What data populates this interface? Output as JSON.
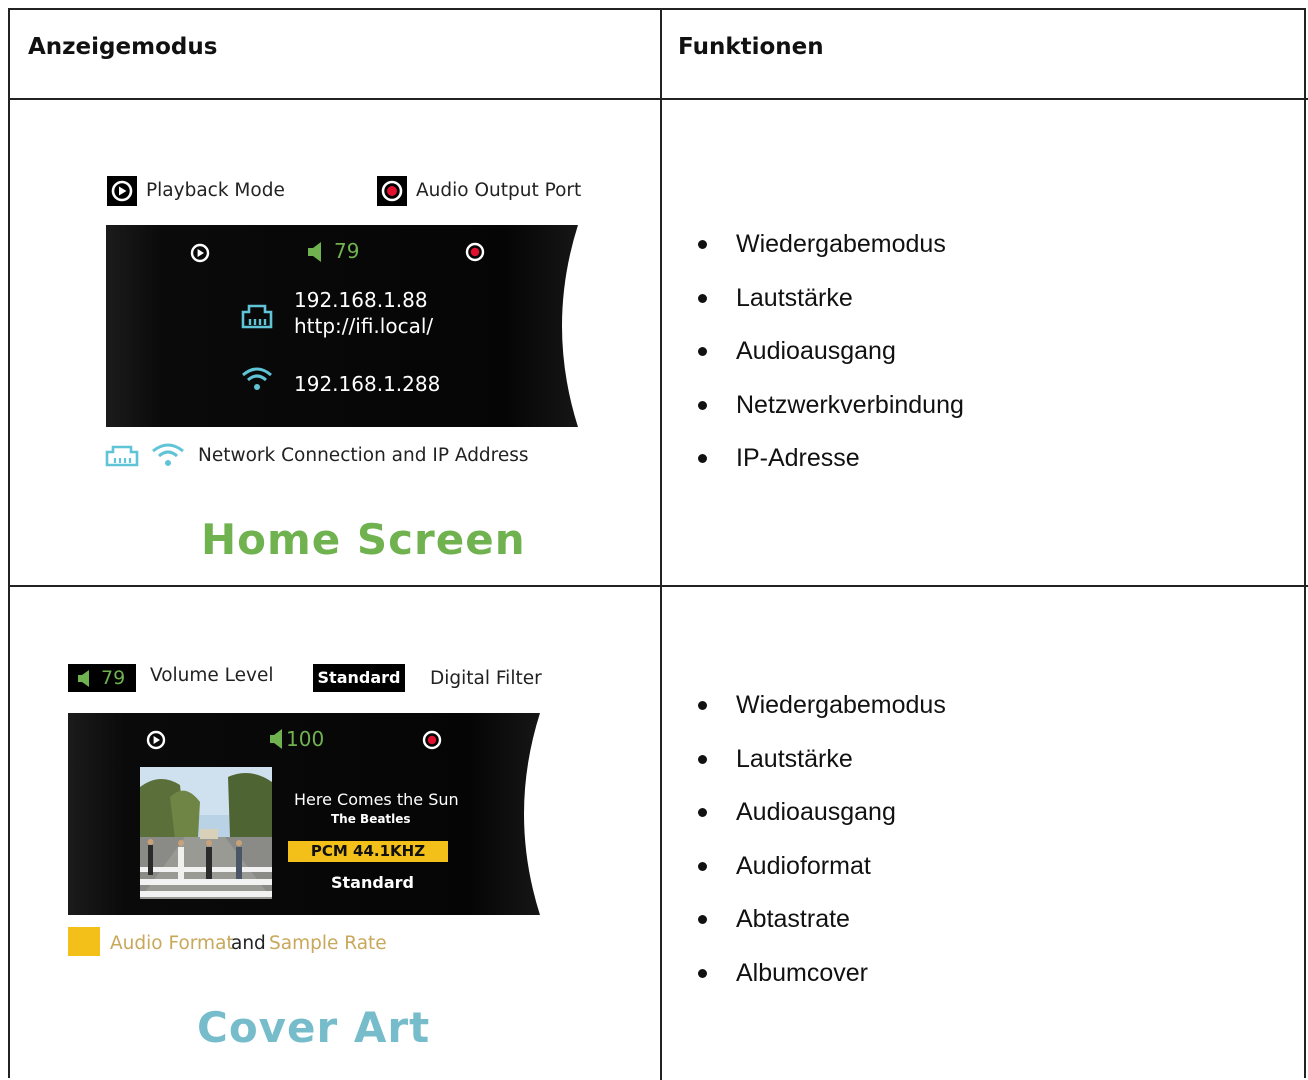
{
  "table": {
    "col1_header": "Anzeigemodus",
    "col2_header": "Funktionen"
  },
  "rows": [
    {
      "legend": {
        "playback_mode": "Playback Mode",
        "audio_output_port": "Audio Output Port",
        "network_connection": "Network Connection and IP Address"
      },
      "screen": {
        "volume": "79",
        "ip_wired": "192.168.1.88",
        "url": "http://ifi.local/",
        "ip_wifi": "192.168.1.288"
      },
      "title": "Home Screen",
      "title_color": "#6fb24f",
      "features": [
        "Wiedergabemodus",
        "Lautstärke",
        "Audioausgang",
        "Netzwerkverbindung",
        "IP-Adresse"
      ]
    },
    {
      "legend": {
        "volume_value": "79",
        "volume_level": "Volume Level",
        "filter_badge": "Standard",
        "digital_filter": "Digital Filter",
        "audio_format": "Audio Format",
        "and": "and",
        "sample_rate": "Sample Rate"
      },
      "screen": {
        "volume": "100",
        "track": "Here Comes the Sun",
        "artist": "The Beatles",
        "format": "PCM 44.1KHZ",
        "filter": "Standard"
      },
      "title": "Cover Art",
      "title_color": "#76bccb",
      "features": [
        "Wiedergabemodus",
        "Lautstärke",
        "Audioausgang",
        "Audioformat",
        "Abtastrate",
        "Albumcover"
      ]
    }
  ],
  "colors": {
    "green": "#6fb24f",
    "teal": "#5fc4d6",
    "red": "#e0102e",
    "yellow": "#f3c01a",
    "gold_text": "#c8a85a"
  }
}
